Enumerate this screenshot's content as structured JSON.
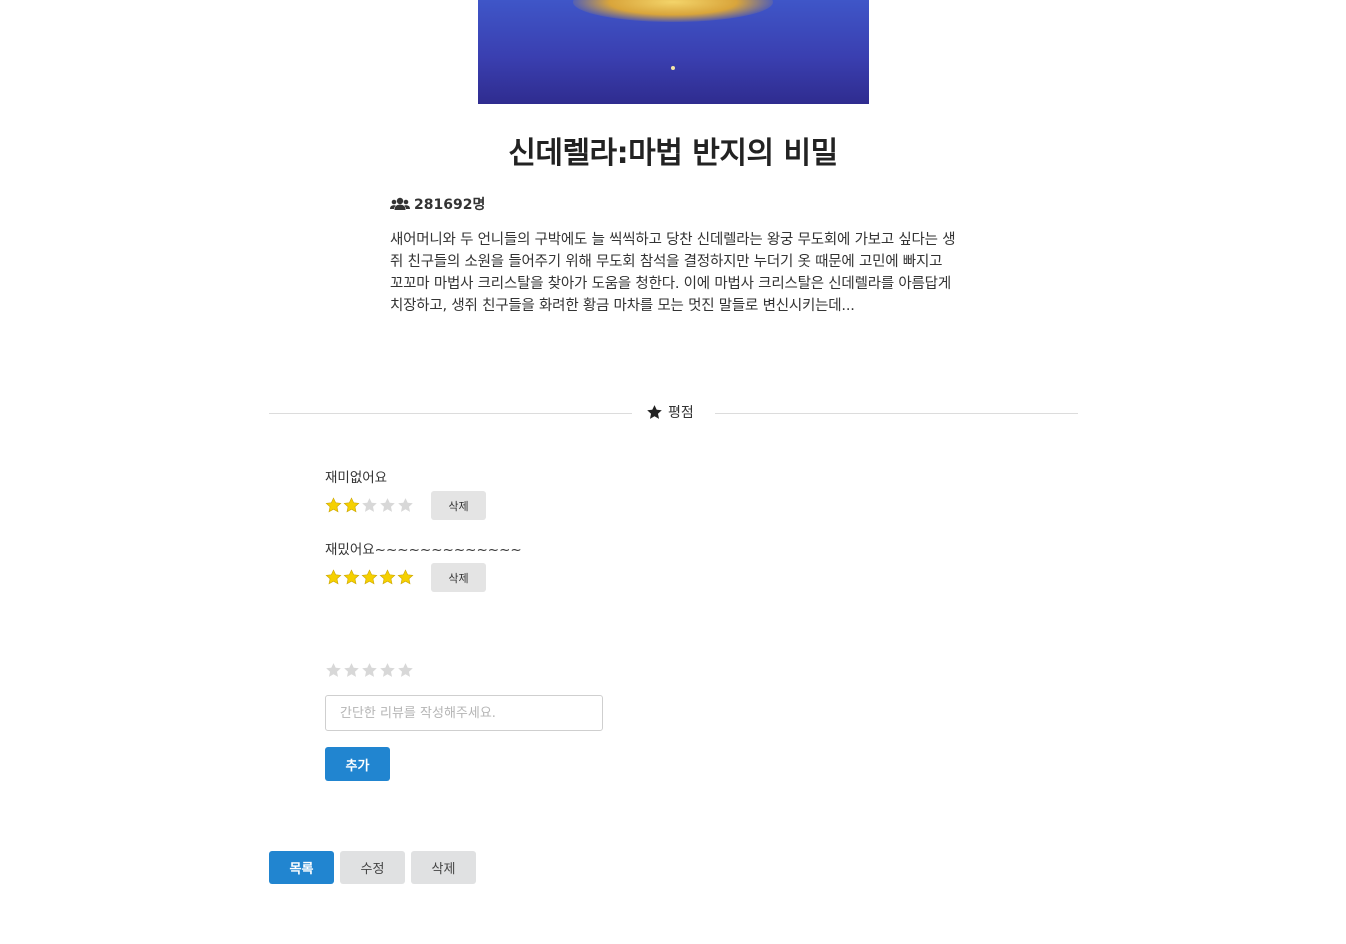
{
  "movie": {
    "title": "신데렐라:마법 반지의 비밀",
    "audience": "281692명",
    "description": "새어머니와 두 언니들의 구박에도 늘 씩씩하고 당찬 신데렐라는 왕궁 무도회에 가보고 싶다는 생쥐 친구들의 소원을 들어주기 위해 무도회 참석을 결정하지만 누더기 옷 때문에 고민에 빠지고 꼬꼬마 마법사 크리스탈을 찾아가 도움을 청한다. 이에 마법사 크리스탈은 신데렐라를 아름답게 치장하고, 생쥐 친구들을 화려한 황금 마차를 모는 멋진 말들로 변신시키는데..."
  },
  "rating_section": {
    "heading": "평점",
    "icon": "star-icon"
  },
  "reviews": [
    {
      "text": "재미없어요",
      "rating": 2,
      "delete_label": "삭제"
    },
    {
      "text": "재밌어요~~~~~~~~~~~~~",
      "rating": 5,
      "delete_label": "삭제"
    }
  ],
  "new_review": {
    "rating": 0,
    "placeholder": "간단한 리뷰를 작성해주세요.",
    "add_label": "추가"
  },
  "actions": {
    "list_label": "목록",
    "edit_label": "수정",
    "delete_label": "삭제"
  },
  "colors": {
    "primary": "#2185d0",
    "star_on": "#f5d000",
    "star_off": "#d8d8d8",
    "button_grey": "#e0e1e2"
  }
}
